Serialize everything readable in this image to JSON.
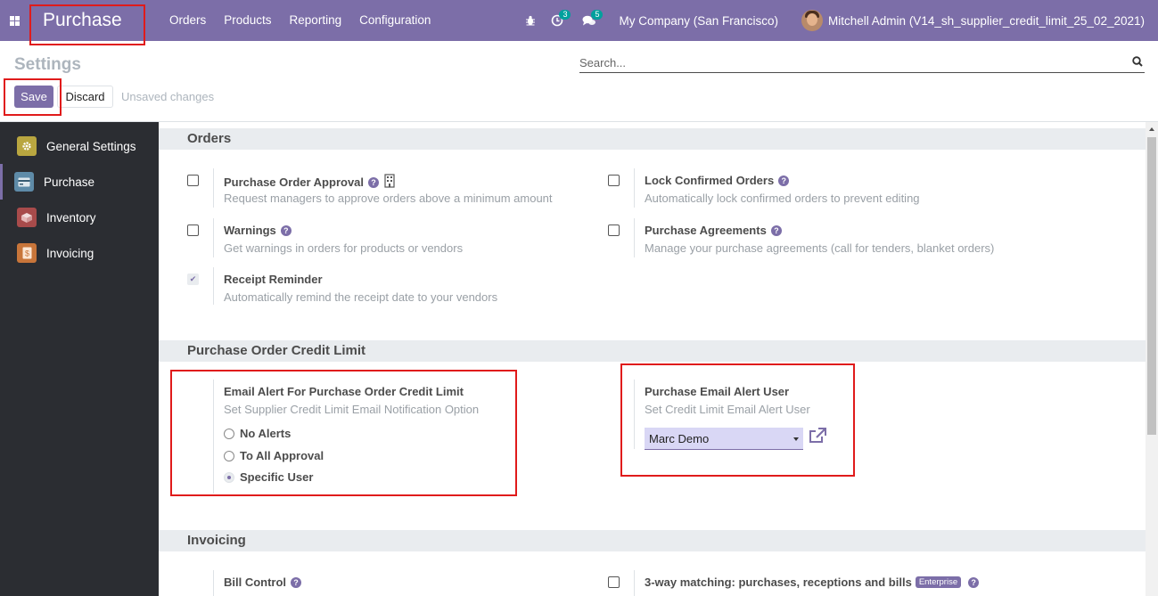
{
  "navbar": {
    "app_name": "Purchase",
    "menu": [
      "Orders",
      "Products",
      "Reporting",
      "Configuration"
    ],
    "activity_count": "3",
    "message_count": "5",
    "company": "My Company (San Francisco)",
    "user": "Mitchell Admin (V14_sh_supplier_credit_limit_25_02_2021)"
  },
  "control": {
    "title": "Settings",
    "search_placeholder": "Search...",
    "save_label": "Save",
    "discard_label": "Discard",
    "status": "Unsaved changes"
  },
  "sidebar": {
    "items": [
      {
        "label": "General Settings",
        "icon": "gear-icon",
        "color": "#b9a640"
      },
      {
        "label": "Purchase",
        "icon": "purchase-icon",
        "color": "#5e8ba8"
      },
      {
        "label": "Inventory",
        "icon": "inventory-icon",
        "color": "#a84b4b"
      },
      {
        "label": "Invoicing",
        "icon": "invoicing-icon",
        "color": "#c8753a"
      }
    ]
  },
  "sections": {
    "orders": {
      "title": "Orders",
      "settings": [
        {
          "label": "Purchase Order Approval",
          "desc": "Request managers to approve orders above a minimum amount",
          "checked": false
        },
        {
          "label": "Lock Confirmed Orders",
          "desc": "Automatically lock confirmed orders to prevent editing",
          "checked": false
        },
        {
          "label": "Warnings",
          "desc": "Get warnings in orders for products or vendors",
          "checked": false
        },
        {
          "label": "Purchase Agreements",
          "desc": "Manage your purchase agreements (call for tenders, blanket orders)",
          "checked": false
        },
        {
          "label": "Receipt Reminder",
          "desc": "Automatically remind the receipt date to your vendors",
          "checked": true
        }
      ]
    },
    "credit_limit": {
      "title": "Purchase Order Credit Limit",
      "email_alert": {
        "label": "Email Alert For Purchase Order Credit Limit",
        "desc": "Set Supplier Credit Limit Email Notification Option",
        "options": [
          "No Alerts",
          "To All Approval",
          "Specific User"
        ],
        "selected": "Specific User"
      },
      "alert_user": {
        "label": "Purchase Email Alert User",
        "desc": "Set Credit Limit Email Alert User",
        "value": "Marc Demo"
      }
    },
    "invoicing": {
      "title": "Invoicing",
      "bill_control": {
        "label": "Bill Control"
      },
      "three_way": {
        "label": "3-way matching: purchases, receptions and bills",
        "badge": "Enterprise",
        "checked": false
      }
    }
  }
}
